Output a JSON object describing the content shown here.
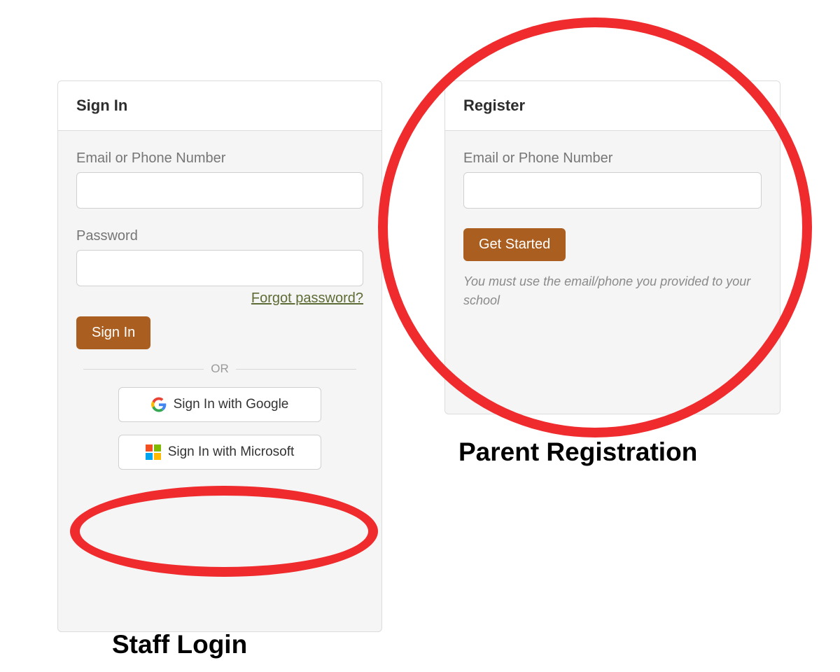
{
  "signin": {
    "title": "Sign In",
    "email_label": "Email or Phone Number",
    "email_value": "",
    "password_label": "Password",
    "password_value": "",
    "forgot_label": "Forgot password?",
    "submit_label": "Sign In",
    "divider_label": "OR",
    "google_label": "Sign In with Google",
    "microsoft_label": "Sign In with Microsoft"
  },
  "register": {
    "title": "Register",
    "email_label": "Email or Phone Number",
    "email_value": "",
    "submit_label": "Get Started",
    "hint": "You must use the email/phone you provided to your school"
  },
  "annotations": {
    "staff_login": "Staff Login",
    "parent_registration": "Parent Registration"
  },
  "colors": {
    "primary_button": "#aa5f20",
    "annotation_ring": "#ef2b2d",
    "link_olive": "#5d6b34",
    "ms_red": "#f25022",
    "ms_green": "#7fba00",
    "ms_blue": "#00a4ef",
    "ms_yellow": "#ffb900",
    "google_blue": "#4285F4",
    "google_red": "#EA4335",
    "google_yellow": "#FBBC05",
    "google_green": "#34A853"
  }
}
